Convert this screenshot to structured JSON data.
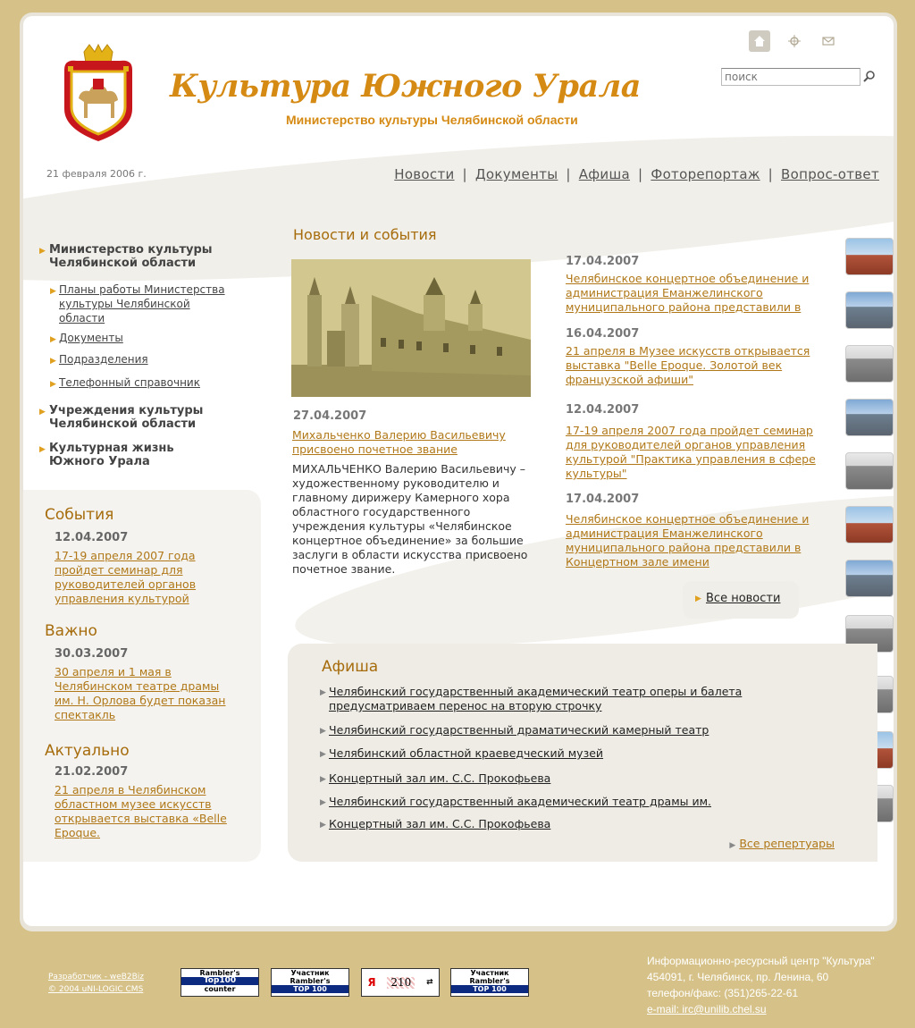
{
  "header": {
    "title": "Культура Южного Урала",
    "subtitle": "Министерство культуры Челябинской области",
    "date": "21 февраля 2006 г.",
    "search_placeholder": "поиск"
  },
  "top_icons": [
    "home-icon",
    "sitemap-icon",
    "mail-icon"
  ],
  "nav": [
    "Новости",
    "Документы",
    "Афиша",
    "Фоторепортаж",
    "Вопрос-ответ"
  ],
  "left_menu": {
    "ministry": "Министерство культуры Челябинской области",
    "ministry_line1": "Министерство культуры",
    "ministry_line2": "Челябинской области",
    "sub": [
      "Планы работы Министерства культуры Челябинской области",
      "Документы",
      "Подразделения",
      "Телефонный справочник"
    ],
    "sub0_l1": "Планы работы Министерства",
    "sub0_l2": "культуры Челябинской",
    "sub0_l3": "области",
    "inst_l1": "Учреждения культуры",
    "inst_l2": "Челябинской области",
    "life_l1": "Культурная жизнь",
    "life_l2": "Южного Урала"
  },
  "left_box": {
    "events": {
      "heading": "События",
      "date": "12.04.2007",
      "text": "17-19 апреля 2007 года пройдет семинар для руководителей органов управления культурой"
    },
    "important": {
      "heading": "Важно",
      "date": "30.03.2007",
      "text": "30 апреля и 1 мая в Челябинском театре драмы им. Н. Орлова будет показан спектакль"
    },
    "actual": {
      "heading": "Актуально",
      "date": "21.02.2007",
      "text": "21 апреля в Челябинском областном музее искусств открывается выставка «Belle Epoque."
    }
  },
  "news": {
    "heading": "Новости и события",
    "main": {
      "date": "27.04.2007",
      "title": "Михальченко Валерию Васильевичу присвоено почетное звание",
      "body": "МИХАЛЬЧЕНКО Валерию Васильевичу – художественному руководителю и главному дирижеру Камерного хора областного государственного учреждения культуры «Челябинское концертное объединение» за большие заслуги в области искусства присвоено почетное звание."
    },
    "items": [
      {
        "date": "17.04.2007",
        "text": "Челябинское концертное объединение и администрация Еманжелинского муниципального района представили в"
      },
      {
        "date": "16.04.2007",
        "text": "21 апреля в Музее искусств открывается выставка \"Belle Epoque. Золотой век французской афиши\""
      },
      {
        "date": "12.04.2007",
        "text": "17-19 апреля 2007 года пройдет семинар для руководителей органов управления культурой \"Практика управления в сфере культуры\""
      },
      {
        "date": "17.04.2007",
        "text": "Челябинское концертное объединение и администрация Еманжелинского муниципального района представили в Концертном зале имени"
      }
    ],
    "all_label": "Все новости"
  },
  "afisha": {
    "heading": "Афиша",
    "items": [
      "Челябинский государственный академический театр оперы и балета предусматриваем перенос на вторую строчку",
      "Челябинский государственный драматический камерный театр",
      "Челябинский областной краеведческий музей",
      "Концертный зал им. С.С. Прокофьева",
      "Челябинский государственный академический театр драмы им.",
      "Концертный зал им. С.С. Прокофьева"
    ],
    "item0_l1": "Челябинский государственный академический театр оперы и балета",
    "item0_l2": "предусматриваем перенос на вторую строчку",
    "all_label": "Все репертуары"
  },
  "footer": {
    "dev_line1": "Разработчик - weB2Biz",
    "dev_line2": "© 2004 uNI-LOGIC CMS",
    "counters": [
      {
        "l1": "Rambler's",
        "l2": "Top100",
        "l3": "counter"
      },
      {
        "l1": "Участник",
        "l2": "Rambler's",
        "l3": "TOP 100"
      },
      {
        "l1": "Я",
        "l2": "210",
        "l3": ""
      },
      {
        "l1": "Участник",
        "l2": "Rambler's",
        "l3": "TOP 100"
      }
    ],
    "contact": {
      "org": "Информационно-ресурсный центр \"Культура\"",
      "address": "454091, г. Челябинск, пр. Ленина, 60",
      "phone": "телефон/факс: (351)265-22-61",
      "email": "e-mail: irc@unilib.chel.su"
    }
  },
  "colors": {
    "accent": "#d58a14",
    "background": "#d6c289",
    "link": "#b07818"
  }
}
